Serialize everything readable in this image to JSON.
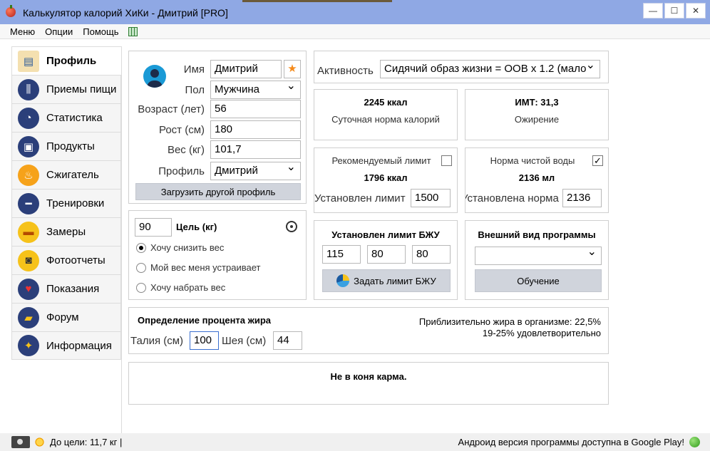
{
  "window": {
    "title": "Калькулятор калорий ХиКи - Дмитрий [PRO]",
    "controls": [
      "—",
      "☐",
      "✕"
    ]
  },
  "menu": {
    "items": [
      "Меню",
      "Опции",
      "Помощь"
    ]
  },
  "sidebar": {
    "items": [
      {
        "label": "Профиль",
        "icon": "profile-card-icon",
        "glyph": "▤"
      },
      {
        "label": "Приемы пищи",
        "icon": "fork-knife-icon",
        "glyph": "⫼"
      },
      {
        "label": "Статистика",
        "icon": "pie-chart-icon",
        "glyph": "◔"
      },
      {
        "label": "Продукты",
        "icon": "grocery-bag-icon",
        "glyph": "▣"
      },
      {
        "label": "Сжигатель",
        "icon": "flame-icon",
        "glyph": "♨"
      },
      {
        "label": "Тренировки",
        "icon": "dumbbell-icon",
        "glyph": "━"
      },
      {
        "label": "Замеры",
        "icon": "tape-measure-icon",
        "glyph": "▬"
      },
      {
        "label": "Фотоотчеты",
        "icon": "camera-icon",
        "glyph": "◙"
      },
      {
        "label": "Показания",
        "icon": "heart-pulse-icon",
        "glyph": "♥"
      },
      {
        "label": "Форум",
        "icon": "chat-bubbles-icon",
        "glyph": "▰"
      },
      {
        "label": "Информация",
        "icon": "lightbulb-icon",
        "glyph": "✦"
      }
    ]
  },
  "profile": {
    "name_label": "Имя",
    "name_value": "Дмитрий",
    "sex_label": "Пол",
    "sex_value": "Мужчина",
    "age_label": "Возраст (лет)",
    "age_value": "56",
    "height_label": "Рост (см)",
    "height_value": "180",
    "weight_label": "Вес (кг)",
    "weight_value": "101,7",
    "profile_label": "Профиль",
    "profile_value": "Дмитрий",
    "load_button": "Загрузить другой профиль"
  },
  "goal": {
    "value": "90",
    "label": "Цель (кг)",
    "options": [
      "Хочу снизить вес",
      "Мой вес меня устраивает",
      "Хочу набрать вес"
    ],
    "selected": 0
  },
  "activity": {
    "label": "Активность",
    "value": "Сидячий образ жизни = ООВ х 1.2 (мало"
  },
  "daily": {
    "value": "2245 ккал",
    "caption": "Суточная норма калорий"
  },
  "bmi": {
    "value": "ИМТ: 31,3",
    "caption": "Ожирение"
  },
  "limit": {
    "title": "Рекомендуемый лимит",
    "value": "1796 ккал",
    "set_label": "Установлен лимит",
    "set_value": "1500",
    "checked": false
  },
  "water": {
    "title": "Норма чистой воды",
    "value": "2136 мл",
    "set_label": "Установлена норма",
    "set_value": "2136",
    "check_glyph": "✓"
  },
  "bju": {
    "title": "Установлен лимит БЖУ",
    "p": "115",
    "f": "80",
    "c": "80",
    "button": "Задать лимит БЖУ"
  },
  "appearance": {
    "title": "Внешний вид программы",
    "value": "",
    "button": "Обучение"
  },
  "fat": {
    "title": "Определение процента жира",
    "waist_label": "Талия (см)",
    "waist_value": "100",
    "neck_label": "Шея (см)",
    "neck_value": "44",
    "result_line1": "Приблизительно жира в организме: 22,5%",
    "result_line2": "19-25% удовлетворительно"
  },
  "quote": "Не в коня карма.",
  "status": {
    "goal_text": "До цели: 11,7 кг |",
    "android_text": "Андроид версия программы доступна в Google Play!"
  }
}
